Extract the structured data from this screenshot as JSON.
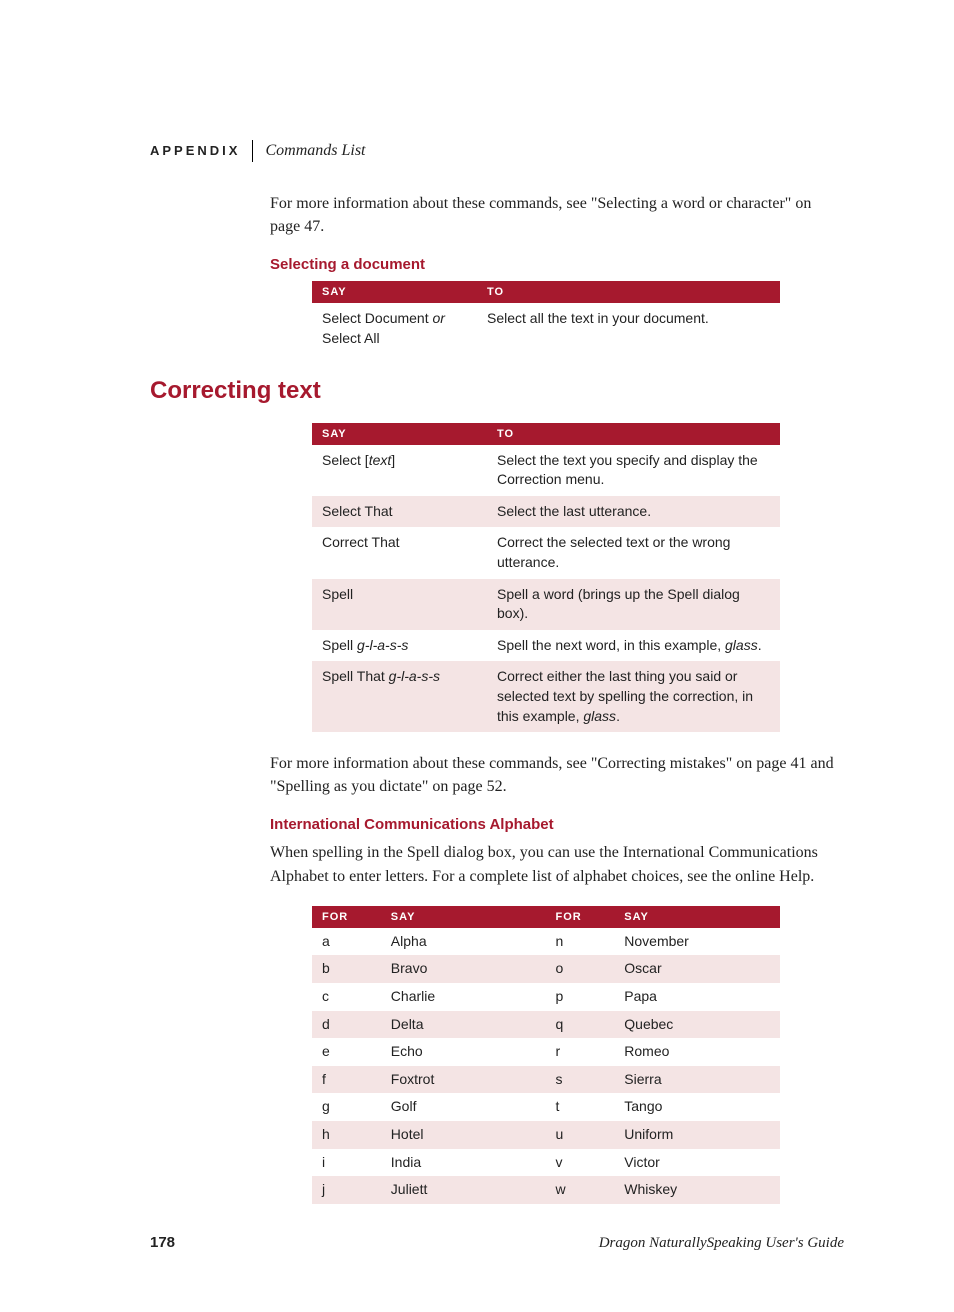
{
  "runningHead": {
    "left": "APPENDIX",
    "right": "Commands List"
  },
  "para1": "For more information about these commands, see \"Selecting a word or character\" on page 47.",
  "subhead1": "Selecting a document",
  "table1": {
    "headers": [
      "SAY",
      "TO"
    ],
    "rows": [
      {
        "say_pre": "Select Document ",
        "say_italic": "or",
        "say_post": " Select All",
        "to": "Select all the text in your document."
      }
    ]
  },
  "sectionTitle": "Correcting text",
  "table2": {
    "headers": [
      "SAY",
      "TO"
    ],
    "rows": [
      {
        "say_pre": "Select [",
        "say_italic": "text",
        "say_post": "]",
        "to": "Select the text you specify and display the Correction menu."
      },
      {
        "say_pre": "Select That",
        "say_italic": "",
        "say_post": "",
        "to": "Select the last utterance."
      },
      {
        "say_pre": "Correct That",
        "say_italic": "",
        "say_post": "",
        "to": "Correct the selected text or the wrong utterance."
      },
      {
        "say_pre": "Spell",
        "say_italic": "",
        "say_post": "",
        "to": "Spell a word (brings up the Spell dialog box)."
      },
      {
        "say_pre": "Spell ",
        "say_italic": "g-l-a-s-s",
        "say_post": "",
        "to_pre": "Spell the next word, in this example, ",
        "to_italic": "glass",
        "to_post": "."
      },
      {
        "say_pre": "Spell That ",
        "say_italic": "g-l-a-s-s",
        "say_post": "",
        "to_pre": "Correct either the last thing you said or selected text by spelling the correction, in this example, ",
        "to_italic": "glass",
        "to_post": "."
      }
    ]
  },
  "para2": "For more information about these commands, see \"Correcting mistakes\" on page 41 and \"Spelling as you dictate\" on page 52.",
  "subhead2": "International Communications Alphabet",
  "para3": "When spelling in the Spell dialog box, you can use the International Communications Alphabet to enter letters. For a complete list of alphabet choices, see the online Help.",
  "alphaHeaders": [
    "FOR",
    "SAY",
    "FOR",
    "SAY"
  ],
  "alpha": [
    {
      "l1": "a",
      "w1": "Alpha",
      "l2": "n",
      "w2": "November"
    },
    {
      "l1": "b",
      "w1": "Bravo",
      "l2": "o",
      "w2": "Oscar"
    },
    {
      "l1": "c",
      "w1": "Charlie",
      "l2": "p",
      "w2": "Papa"
    },
    {
      "l1": "d",
      "w1": "Delta",
      "l2": "q",
      "w2": "Quebec"
    },
    {
      "l1": "e",
      "w1": "Echo",
      "l2": "r",
      "w2": "Romeo"
    },
    {
      "l1": "f",
      "w1": "Foxtrot",
      "l2": "s",
      "w2": "Sierra"
    },
    {
      "l1": "g",
      "w1": "Golf",
      "l2": "t",
      "w2": "Tango"
    },
    {
      "l1": "h",
      "w1": "Hotel",
      "l2": "u",
      "w2": "Uniform"
    },
    {
      "l1": "i",
      "w1": "India",
      "l2": "v",
      "w2": "Victor"
    },
    {
      "l1": "j",
      "w1": "Juliett",
      "l2": "w",
      "w2": "Whiskey"
    }
  ],
  "footer": {
    "pageNum": "178",
    "bookTitle": "Dragon NaturallySpeaking User's Guide"
  }
}
